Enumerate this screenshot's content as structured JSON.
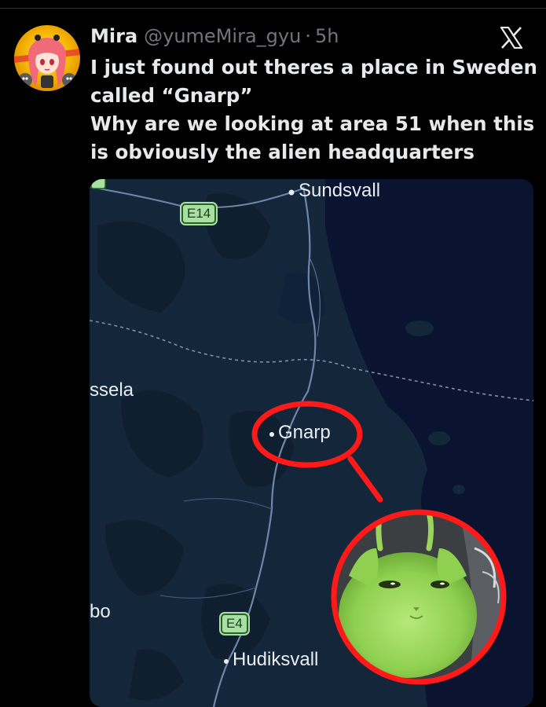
{
  "tweet": {
    "display_name": "Mira",
    "handle": "@yumeMira_gyu",
    "separator": "·",
    "time": "5h",
    "lines": [
      "I just found out theres a place in Sweden",
      "called “Gnarp”",
      "Why are we looking at area 51 when this",
      "is obviously the alien headquarters"
    ]
  },
  "icons": {
    "platform_logo": "x-logo-icon",
    "avatar": "anime-girl-avatar"
  },
  "map": {
    "labels": {
      "sundsvall": "Sundsvall",
      "gnarp": "Gnarp",
      "hudiksvall": "Hudiksvall",
      "ssela": "ssela",
      "bo": "bo"
    },
    "road_shields": {
      "e14": "E14",
      "e4": "E4"
    },
    "colors": {
      "land": "#14263a",
      "sea": "#0a1330",
      "highlight_circle": "#ff1a1a"
    }
  }
}
